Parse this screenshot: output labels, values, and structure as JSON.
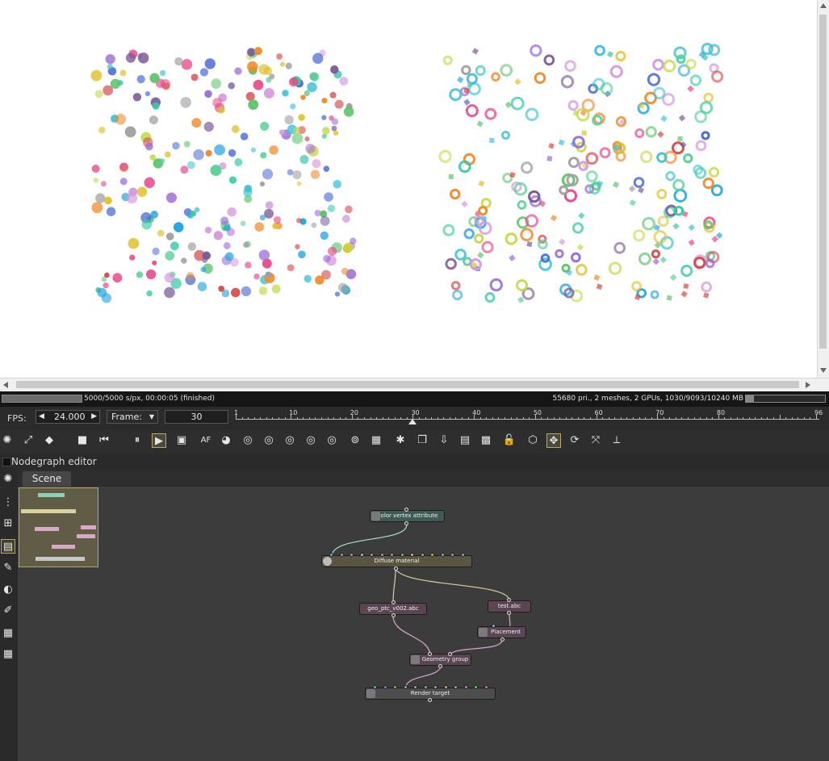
{
  "viewport": {
    "label": "render viewport",
    "dot_palette": [
      "#e84a8a",
      "#3fc3d8",
      "#9a6bd6",
      "#f08a2a",
      "#5cc46b",
      "#c7d84a",
      "#4a6bd6",
      "#d64a4a",
      "#a0a0a0",
      "#36c9a5",
      "#d69ae0",
      "#2aa8e0",
      "#e0c02a",
      "#7a5c9a",
      "#58d19a"
    ]
  },
  "status": {
    "left": "5000/5000 s/px, 00:00:05 (finished)",
    "right": "55680 pri., 2 meshes, 2 GPUs, 1030/9093/10240 MB",
    "progress": 1.0,
    "memory": 0.1
  },
  "timebar": {
    "fps_label": "FPS:",
    "fps_value": "24.000",
    "frame_label": "Frame:",
    "frame_value": "30",
    "ruler_ticks": [
      "1",
      "10",
      "20",
      "30",
      "40",
      "50",
      "60",
      "70",
      "80",
      "96"
    ],
    "ruler_min": 1,
    "ruler_max": 96,
    "current_frame": 30
  },
  "toolbar": {
    "icons": [
      "render-settings-icon",
      "fit-view-icon",
      "color-cube-icon",
      "stop-icon",
      "rewind-icon",
      "pause-icon",
      "play-icon",
      "monitor-icon",
      "af-icon",
      "color-wheel-icon",
      "camera-1-icon",
      "camera-2-icon",
      "camera-3-icon",
      "camera-4-icon",
      "camera-5-icon",
      "zoom-icon",
      "region-icon",
      "picker-icon",
      "copy-icon",
      "export-icon",
      "layers-icon",
      "checker-icon",
      "lock-icon",
      "cube-icon",
      "move-icon",
      "rotate-icon",
      "fullscreen-icon",
      "axis-icon"
    ],
    "glyphs": [
      "✺",
      "⤢",
      "◆",
      "■",
      "⏮",
      "⏸",
      "▶",
      "▣",
      "AF",
      "◕",
      "◎",
      "◎",
      "◎",
      "◎",
      "◎",
      "⊚",
      "▦",
      "✱",
      "❐",
      "⇩",
      "▤",
      "▩",
      "🔓",
      "⬡",
      "✥",
      "⟳",
      "⤧",
      "⟂"
    ]
  },
  "nodegraph": {
    "title": "Nodegraph editor",
    "tab": "Scene",
    "left_icons": [
      "render-icon",
      "graph-layout-icon",
      "graph-select-icon",
      "graph-view-icon",
      "material-icon",
      "sphere-icon",
      "paint-icon",
      "grid-red-icon",
      "grid-icon"
    ],
    "left_glyphs": [
      "✺",
      "⋮",
      "⊞",
      "▤",
      "✎",
      "◐",
      "✐",
      "▦",
      "▦"
    ],
    "nodes": {
      "color_vertex": "Color vertex attribute",
      "diffuse": "Diffuse material",
      "geo_ptc": "geo_ptc_v002.abc",
      "test_abc": "test.abc",
      "placement": "Placement",
      "geometry_group": "Geometry group",
      "render_target": "Render target"
    },
    "colors": {
      "texture_node": "#3f5a52",
      "material_node": "#5a5540",
      "geometry_node": "#5a4552",
      "render_node": "#4d4d4d",
      "material_wire": "#d8d2a0",
      "geometry_wire": "#d8a8c8",
      "texture_wire": "#a8e0d0"
    }
  }
}
